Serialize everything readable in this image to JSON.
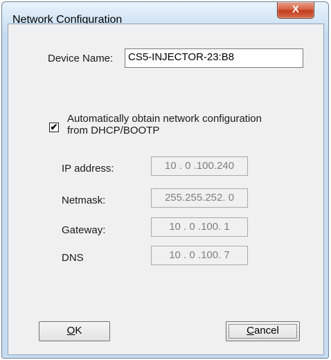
{
  "window": {
    "title": "Network Configuration",
    "close_label": "X"
  },
  "device": {
    "label": "Device Name:",
    "value": "CS5-INJECTOR-23:B8"
  },
  "dhcp": {
    "checked": true,
    "check_glyph": "✔",
    "label_line1": "Automatically obtain network configuration",
    "label_line2": "from DHCP/BOOTP"
  },
  "fields": {
    "ip": {
      "label": "IP address:",
      "value": "10 . 0 .100.240"
    },
    "netmask": {
      "label": "Netmask:",
      "value": "255.255.252. 0"
    },
    "gateway": {
      "label": "Gateway:",
      "value": "10 . 0 .100. 1"
    },
    "dns": {
      "label": "DNS",
      "value": "10 . 0 .100. 7"
    }
  },
  "buttons": {
    "ok_mnemonic": "O",
    "ok_rest": "K",
    "cancel_mnemonic": "C",
    "cancel_rest": "ancel"
  }
}
